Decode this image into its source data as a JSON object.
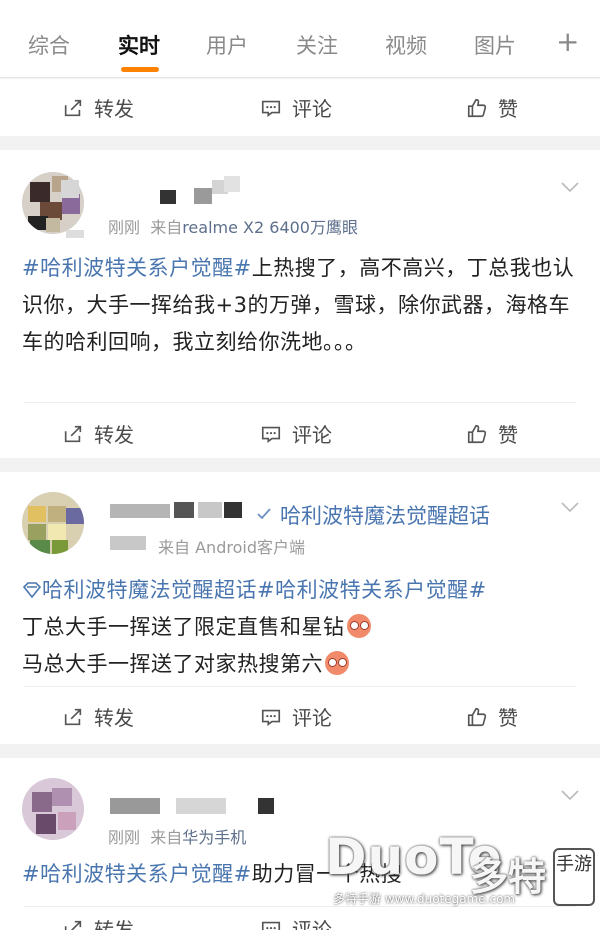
{
  "tabs": [
    {
      "label": "综合"
    },
    {
      "label": "实时"
    },
    {
      "label": "用户"
    },
    {
      "label": "关注"
    },
    {
      "label": "视频"
    },
    {
      "label": "图片"
    }
  ],
  "tab_plus": "+",
  "actions": {
    "share": "转发",
    "comment": "评论",
    "like": "赞"
  },
  "posts": [
    {
      "time": "刚刚",
      "source_prefix": "来自",
      "source": "realme X2 6400万鹰眼",
      "topic": "#哈利波特关系户觉醒#",
      "text": "上热搜了，高不高兴，丁总我也认识你，大手一挥给我+3的万弹，雪球，除你武器，海格车车的哈利回响，我立刻给你洗地。。。"
    },
    {
      "super_topic": "哈利波特魔法觉醒超话",
      "time": "",
      "source_prefix": "来自",
      "source": "Android客户端",
      "topic1": "哈利波特魔法觉醒超话",
      "topic2": "#哈利波特关系户觉醒#",
      "line2": "丁总大手一挥送了限定直售和星钻",
      "line3": "马总大手一挥送了对家热搜第六"
    },
    {
      "time": "刚刚",
      "source_prefix": "来自",
      "source": "华为手机",
      "topic": "#哈利波特关系户觉醒#",
      "text": "助力冒一个热搜"
    }
  ],
  "watermark": {
    "brand": "DuoTe",
    "brand_cn": "多特",
    "badge": "手游",
    "url": "多特手游 www.duotegame.com"
  },
  "colors": {
    "accent": "#ff8200",
    "link": "#4a76b0"
  }
}
